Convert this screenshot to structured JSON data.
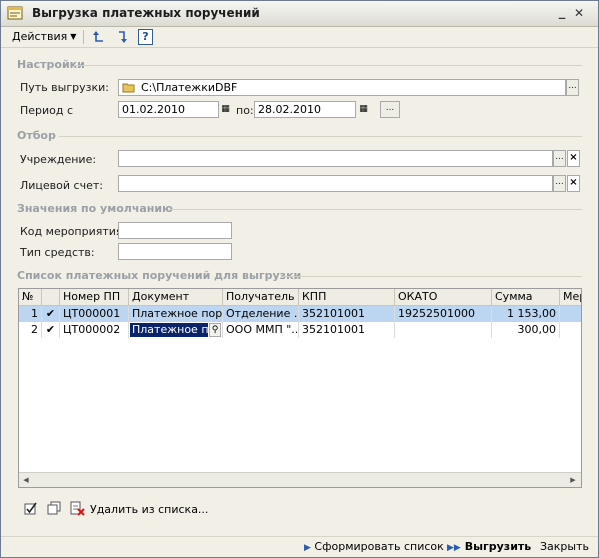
{
  "window": {
    "title": "Выгрузка платежных поручений"
  },
  "toolbar": {
    "actions_label": "Действия",
    "help_label": "?"
  },
  "settings": {
    "header": "Настройки",
    "path_label": "Путь выгрузки:",
    "path_value": "C:\\ПлатежкиDBF",
    "period_label": "Период с",
    "period_from": "01.02.2010",
    "period_to_label": "по:",
    "period_to": "28.02.2010",
    "ellipsis": "..."
  },
  "filter": {
    "header": "Отбор",
    "institution_label": "Учреждение:",
    "institution_value": "",
    "account_label": "Лицевой счет:",
    "account_value": ""
  },
  "defaults": {
    "header": "Значения по умолчанию",
    "event_code_label": "Код мероприятия:",
    "event_code_value": "",
    "fund_type_label": "Тип средств:",
    "fund_type_value": ""
  },
  "list": {
    "header": "Список платежных поручений для выгрузки",
    "columns": [
      "№",
      "",
      "Номер ПП",
      "Документ",
      "Получатель",
      "КПП",
      "ОКАТО",
      "Сумма",
      "Мер"
    ],
    "rows": [
      {
        "n": "1",
        "check": "✔",
        "num": "ЦТ000001",
        "doc": "Платежное пор...",
        "recipient": "Отделение ...",
        "kpp": "352101001",
        "okato": "19252501000",
        "sum": "1 153,00",
        "extra": ""
      },
      {
        "n": "2",
        "check": "✔",
        "num": "ЦТ000002",
        "doc": "Платежное пор",
        "recipient": "ООО ММП \"...",
        "kpp": "352101001",
        "okato": "",
        "sum": "300,00",
        "extra": ""
      }
    ]
  },
  "list_toolbar": {
    "remove_label": "Удалить из списка..."
  },
  "footer": {
    "form_list": "Сформировать список",
    "upload": "Выгрузить",
    "close": "Закрыть"
  },
  "colors": {
    "selection": "#bcd6f2",
    "editing": "#0a246a",
    "section_text": "#9aa0a5"
  }
}
